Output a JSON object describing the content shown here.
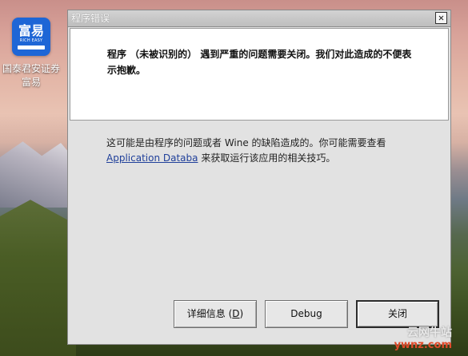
{
  "desktop": {
    "icon": {
      "tile_text": "富易",
      "tile_subtext": "RICH EASY",
      "label_line1": "国泰君安证券",
      "label_line2": "富易"
    }
  },
  "dialog": {
    "title": "程序错误",
    "close_glyph": "✕",
    "message": "程序 （未被识别的） 遇到严重的问题需要关闭。我们对此造成的不便表示抱歉。",
    "info_prefix": "这可能是由程序的问题或者 Wine 的缺陷造成的。你可能需要查看",
    "info_link": "Application Databa",
    "info_suffix": " 来获取运行该应用的相关技巧。",
    "buttons": {
      "details_label": "详细信息 (",
      "details_mnemonic": "D",
      "details_end": ")",
      "debug_label": "Debug",
      "close_label": "关闭"
    }
  },
  "watermark": {
    "main": "云网牛站",
    "sub": "ywnz.com"
  },
  "colors": {
    "link": "#1f3f9a",
    "app_tile": "#1e66d6",
    "watermark_sub": "#e14b2a"
  }
}
